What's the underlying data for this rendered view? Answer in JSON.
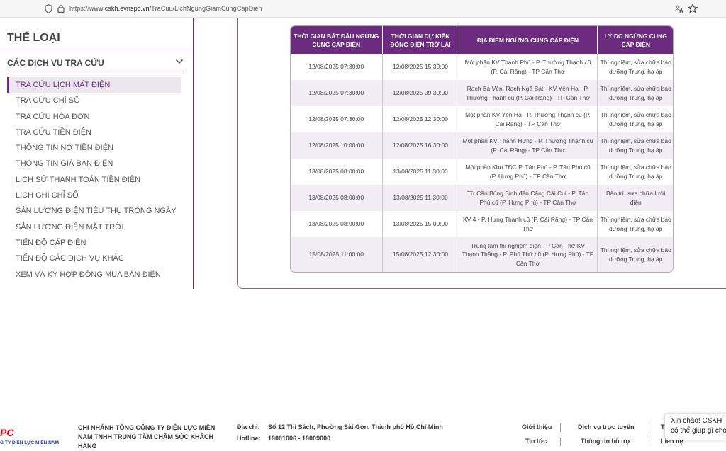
{
  "browser": {
    "url_prefix": "https://www.",
    "url_domain": "cskh.evnspc.vn",
    "url_path": "/TraCuu/LichNgungGiamCungCapDien"
  },
  "sidebar": {
    "category_title": "THỂ LOẠI",
    "section_title": "CÁC DỊCH VỤ TRA CỨU",
    "items": [
      {
        "label": "TRA CỨU LỊCH MẤT ĐIỆN",
        "active": true
      },
      {
        "label": "TRA CỨU CHỈ SỐ"
      },
      {
        "label": "TRA CỨU HÓA ĐƠN"
      },
      {
        "label": "TRA CỨU TIỀN ĐIỆN"
      },
      {
        "label": "THÔNG TIN NỢ TIỀN ĐIỆN"
      },
      {
        "label": "THÔNG TIN GIÁ BÁN ĐIỆN"
      },
      {
        "label": "LỊCH SỬ THANH TOÁN TIỀN ĐIỆN"
      },
      {
        "label": "LỊCH GHI CHỈ SỐ"
      },
      {
        "label": "SẢN LƯỢNG ĐIỆN TIÊU THỤ TRONG NGÀY"
      },
      {
        "label": "SẢN LƯỢNG ĐIỆN MẶT TRỜI"
      },
      {
        "label": "TIẾN ĐỘ CẤP ĐIỆN"
      },
      {
        "label": "TIẾN ĐỘ CÁC DỊCH VỤ KHÁC"
      },
      {
        "label": "XEM VÀ KÝ HỢP ĐỒNG MUA BÁN ĐIỆN"
      }
    ]
  },
  "table": {
    "headers": [
      "THỜI GIAN BẮT ĐẦU NGỪNG CUNG CẤP ĐIỆN",
      "THỜI GIAN DỰ KIẾN ĐÓNG ĐIỆN TRỞ LẠI",
      "ĐỊA ĐIỂM NGỪNG CUNG CẤP ĐIỆN",
      "LÝ DO NGỪNG CUNG CẤP ĐIỆN"
    ],
    "rows": [
      [
        "12/08/2025 07:30:00",
        "12/08/2025 15:30:00",
        "Một phần KV Thạnh Phú - P. Thường Thạnh cũ (P. Cái Răng) - TP Cần Thơ",
        "Thí nghiệm, sửa chữa bảo dưỡng Trung, hạ áp"
      ],
      [
        "12/08/2025 07:30:00",
        "12/08/2025 09:30:00",
        "Rạch Bà Vèn, Rạch Ngã Bát - KV Yên Hạ - P. Thường Thạnh cũ (P. Cái Răng) - TP Cần Thơ",
        "Thí nghiệm, sửa chữa bảo dưỡng Trung, hạ áp"
      ],
      [
        "12/08/2025 07:30:00",
        "12/08/2025 12:30:00",
        "Một phần KV Yên Hạ - P. Thường Thạnh cũ (P. Cái Răng) - TP Cần Thơ",
        "Thí nghiệm, sửa chữa bảo dưỡng Trung, hạ áp"
      ],
      [
        "12/08/2025 10:00:00",
        "12/08/2025 16:30:00",
        "Một phần KV Thạnh Hưng - P. Thường Thạnh cũ (P. Cái Răng) - TP Cần Thơ",
        "Thí nghiệm, sửa chữa bảo dưỡng Trung, hạ áp"
      ],
      [
        "13/08/2025 08:00:00",
        "13/08/2025 11:30:00",
        "Một phần Khu TĐC P. Tân Phú - P. Tân Phú cũ (P. Hưng Phú) - TP Cần Thơ",
        "Thí nghiệm, sửa chữa bảo dưỡng Trung, hạ áp"
      ],
      [
        "13/08/2025 08:00:00",
        "13/08/2025 11:30:00",
        "Từ Cầu Bùng Binh đến Cảng Cái Cui - P. Tân Phú cũ (P. Hưng Phú) - TP Cần Thơ",
        "Bảo trì, sửa chữa lưới điện"
      ],
      [
        "13/08/2025 08:00:00",
        "13/08/2025 15:00:00",
        "KV 4 - P. Hưng Thạnh cũ (P. Cái Răng) - TP Cần Thơ",
        "Thí nghiệm, sửa chữa bảo dưỡng Trung, hạ áp"
      ],
      [
        "15/08/2025 11:00:00",
        "15/08/2025 12:30:00",
        "Trung tâm thí nghiệm điện TP Cần Thơ KV Thạnh Thắng - P. Phú Thứ cũ (P. Hưng Phú) - TP Cần Thơ",
        "Thí nghiệm, sửa chữa bảo dưỡng Trung, hạ áp"
      ]
    ]
  },
  "footer": {
    "logo_text": "PC",
    "logo_sub": "G TY ĐIỆN LỰC MIỀN NAM",
    "company": "CHI NHÁNH TỔNG CÔNG TY ĐIỆN LỰC MIỀN NAM TNHH TRUNG TÂM CHĂM SÓC KHÁCH HÀNG",
    "address_label": "Địa chỉ:",
    "address": "Số 12 Thi Sách, Phường Sài Gòn, Thành phố Hồ Chí Minh",
    "hotline_label": "Hotline:",
    "hotline": "19001006 - 19009000",
    "links_row1": [
      "Giới thiệu",
      "Dịch vụ trực tuyến",
      "T"
    ],
    "links_row2": [
      "Tin tức",
      "Thông tin hỗ trợ",
      "Liên hệ"
    ]
  },
  "chat": {
    "line1": "Xin chào! CSKH",
    "line2": "có thể giúp gì cho"
  }
}
